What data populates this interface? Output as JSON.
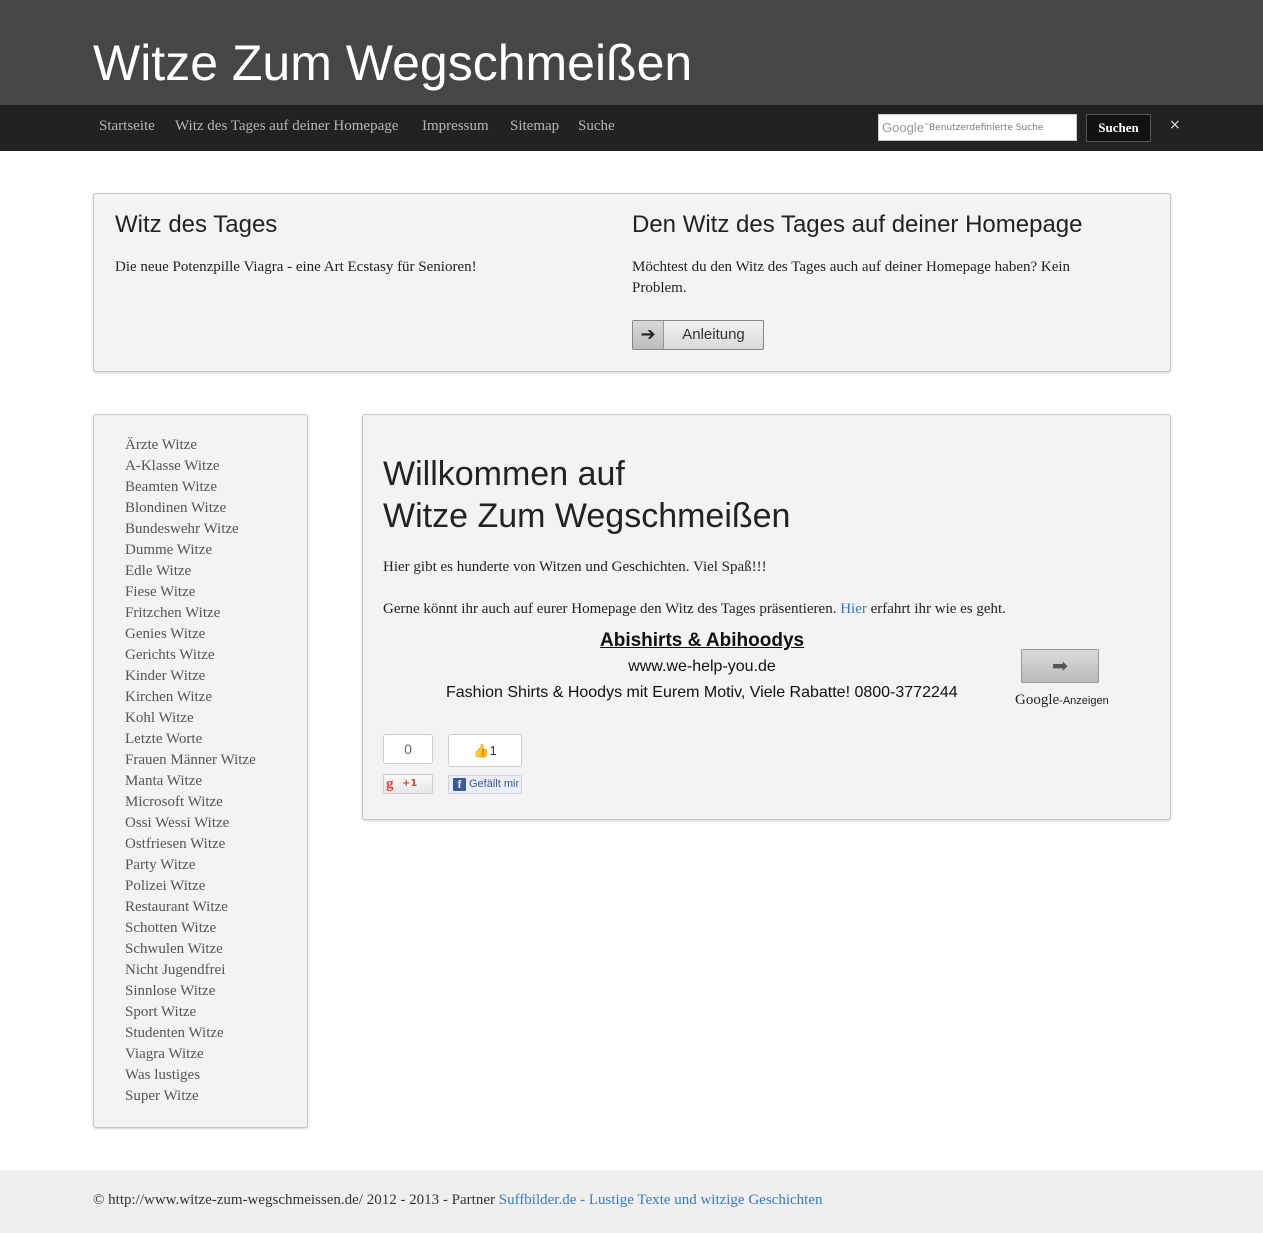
{
  "header": {
    "site_title": "Witze Zum Wegschmeißen"
  },
  "nav": {
    "items": [
      "Startseite",
      "Witz des Tages auf deiner Homepage",
      "Impressum",
      "Sitemap",
      "Suche"
    ]
  },
  "search": {
    "logo": "Google",
    "placeholder": "Benutzerdefinierte Suche",
    "button_label": "Suchen",
    "close_label": "×"
  },
  "witz_des_tages": {
    "heading": "Witz des Tages",
    "text": "Die neue Potenzpille Viagra - eine Art Ecstasy für Senioren!"
  },
  "homepage_widget": {
    "heading": "Den Witz des Tages auf deiner Homepage",
    "text": "Möchtest du den Witz des Tages auch auf deiner Homepage haben? Kein Problem.",
    "button_label": "Anleitung",
    "button_icon": "arrow-right-icon"
  },
  "sidebar": {
    "categories": [
      "Ärzte Witze",
      "A-Klasse Witze",
      "Beamten Witze",
      "Blondinen Witze",
      "Bundeswehr Witze",
      "Dumme Witze",
      "Edle Witze",
      "Fiese Witze",
      "Fritzchen Witze",
      "Genies Witze",
      "Gerichts Witze",
      "Kinder Witze",
      "Kirchen Witze",
      "Kohl Witze",
      "Letzte Worte",
      "Frauen Männer Witze",
      "Manta Witze",
      "Microsoft Witze",
      "Ossi Wessi Witze",
      "Ostfriesen Witze",
      "Party Witze",
      "Polizei Witze",
      "Restaurant Witze",
      "Schotten Witze",
      "Schwulen Witze",
      "Nicht Jugendfrei",
      "Sinnlose Witze",
      "Sport Witze",
      "Studenten Witze",
      "Viagra Witze",
      "Was lustiges",
      "Super Witze"
    ]
  },
  "main": {
    "welcome_line1": "Willkommen auf",
    "welcome_line2": "Witze Zum Wegschmeißen",
    "intro": "Hier gibt es hunderte von Witzen und Geschichten. Viel Spaß!!!",
    "share_prefix": "Gerne könnt ihr auch auf eurer Homepage den Witz des Tages präsentieren.",
    "share_link": "Hier",
    "share_suffix": "erfahrt ihr wie es geht."
  },
  "ad": {
    "title": "Abishirts & Abihoodys",
    "url": "www.we-help-you.de",
    "text": "Fashion Shirts & Hoodys mit Eurem Motiv, Viele Rabatte! 0800-3772244",
    "google_logo": "Google",
    "google_suffix": "-Anzeigen"
  },
  "social": {
    "gplus_count": "0",
    "gplus_label": "+1",
    "fb_count": "1",
    "fb_label": "Gefällt mir"
  },
  "footer": {
    "text": "© http://www.witze-zum-wegschmeissen.de/ 2012 - 2013 - Partner",
    "link": "Suffbilder.de - Lustige Texte und witzige Geschichten"
  },
  "colors": {
    "header_bg": "#464646",
    "navbar_bg": "#222222",
    "link": "#3a7bbd",
    "panel_bg": "#f3f3f3",
    "footer_bg": "#efefef"
  }
}
